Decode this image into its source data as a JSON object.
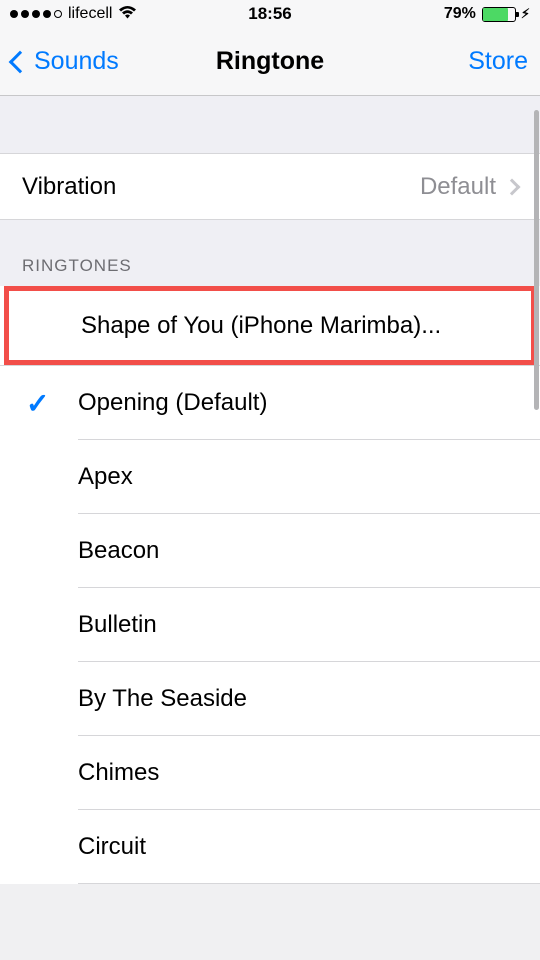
{
  "status": {
    "carrier": "lifecell",
    "time": "18:56",
    "battery_pct": "79%"
  },
  "nav": {
    "back_label": "Sounds",
    "title": "Ringtone",
    "right_label": "Store"
  },
  "vibration": {
    "label": "Vibration",
    "value": "Default"
  },
  "section": {
    "header": "RINGTONES"
  },
  "ringtones": [
    {
      "label": "Shape of You (iPhone Marimba)...",
      "highlighted": true,
      "selected": false
    },
    {
      "label": "Opening (Default)",
      "highlighted": false,
      "selected": true
    },
    {
      "label": "Apex",
      "highlighted": false,
      "selected": false
    },
    {
      "label": "Beacon",
      "highlighted": false,
      "selected": false
    },
    {
      "label": "Bulletin",
      "highlighted": false,
      "selected": false
    },
    {
      "label": "By The Seaside",
      "highlighted": false,
      "selected": false
    },
    {
      "label": "Chimes",
      "highlighted": false,
      "selected": false
    },
    {
      "label": "Circuit",
      "highlighted": false,
      "selected": false
    }
  ]
}
